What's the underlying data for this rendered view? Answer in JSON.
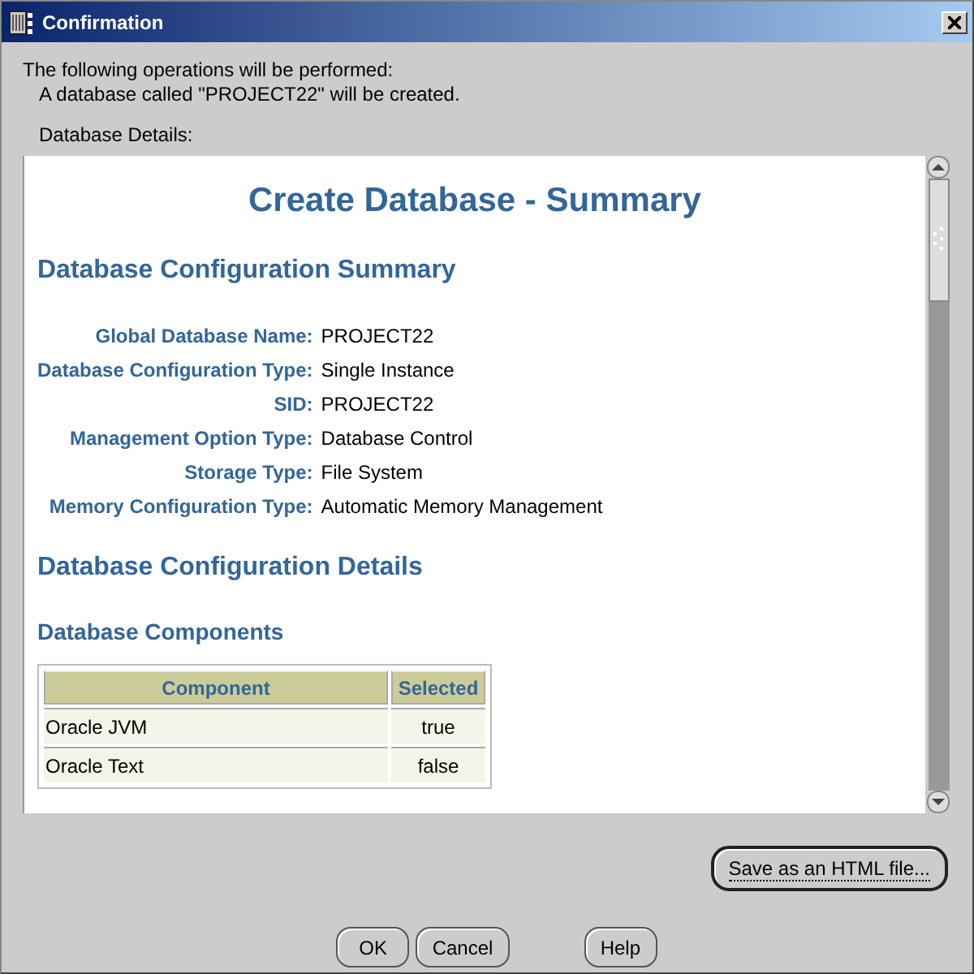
{
  "window": {
    "title": "Confirmation"
  },
  "intro": "The following operations will be performed:",
  "operations": [
    "A database called \"PROJECT22\" will be created."
  ],
  "details_label": "Database Details:",
  "report": {
    "title": "Create Database - Summary",
    "summary_heading": "Database Configuration Summary",
    "fields": [
      {
        "label": "Global Database Name:",
        "value": "PROJECT22"
      },
      {
        "label": "Database Configuration Type:",
        "value": "Single Instance"
      },
      {
        "label": "SID:",
        "value": "PROJECT22"
      },
      {
        "label": "Management Option Type:",
        "value": "Database Control"
      },
      {
        "label": "Storage Type:",
        "value": "File System"
      },
      {
        "label": "Memory Configuration Type:",
        "value": "Automatic Memory Management"
      }
    ],
    "details_heading": "Database Configuration Details",
    "components_heading": "Database Components",
    "table": {
      "columns": [
        "Component",
        "Selected"
      ],
      "rows": [
        [
          "Oracle JVM",
          "true"
        ],
        [
          "Oracle Text",
          "false"
        ]
      ]
    }
  },
  "save_button": "Save as an HTML file...",
  "buttons": [
    "OK",
    "Cancel",
    "Help"
  ]
}
